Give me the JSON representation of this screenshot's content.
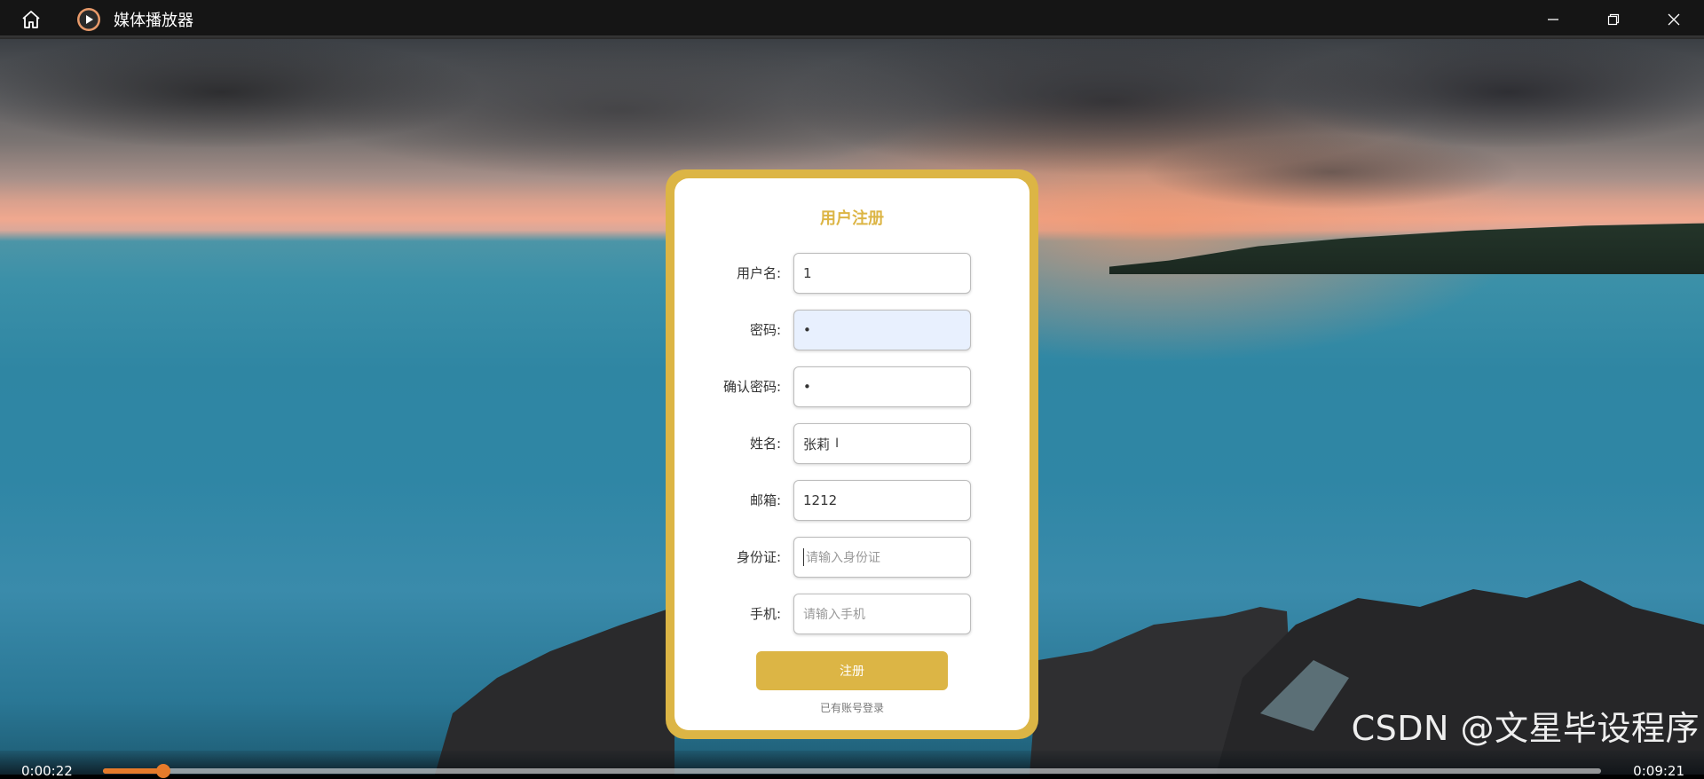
{
  "window": {
    "title": "媒体播放器",
    "controls": [
      "minimize",
      "restore",
      "close"
    ]
  },
  "form": {
    "title": "用户注册",
    "fields": [
      {
        "label": "用户名:",
        "value": "1",
        "placeholder": ""
      },
      {
        "label": "密码:",
        "value": "•",
        "placeholder": ""
      },
      {
        "label": "确认密码:",
        "value": "•",
        "placeholder": ""
      },
      {
        "label": "姓名:",
        "value": "张莉",
        "placeholder": ""
      },
      {
        "label": "邮箱:",
        "value": "1212",
        "placeholder": ""
      },
      {
        "label": "身份证:",
        "value": "",
        "placeholder": "请输入身份证"
      },
      {
        "label": "手机:",
        "value": "",
        "placeholder": "请输入手机"
      }
    ],
    "submit_label": "注册",
    "login_link": "已有账号登录"
  },
  "player": {
    "current_time": "0:00:22",
    "total_time": "0:09:21",
    "progress_percent": 4
  },
  "watermark": "CSDN @文星毕设程序",
  "colors": {
    "accent": "#dcb545",
    "progress": "#e67b2b",
    "titlebar": "#151515"
  }
}
